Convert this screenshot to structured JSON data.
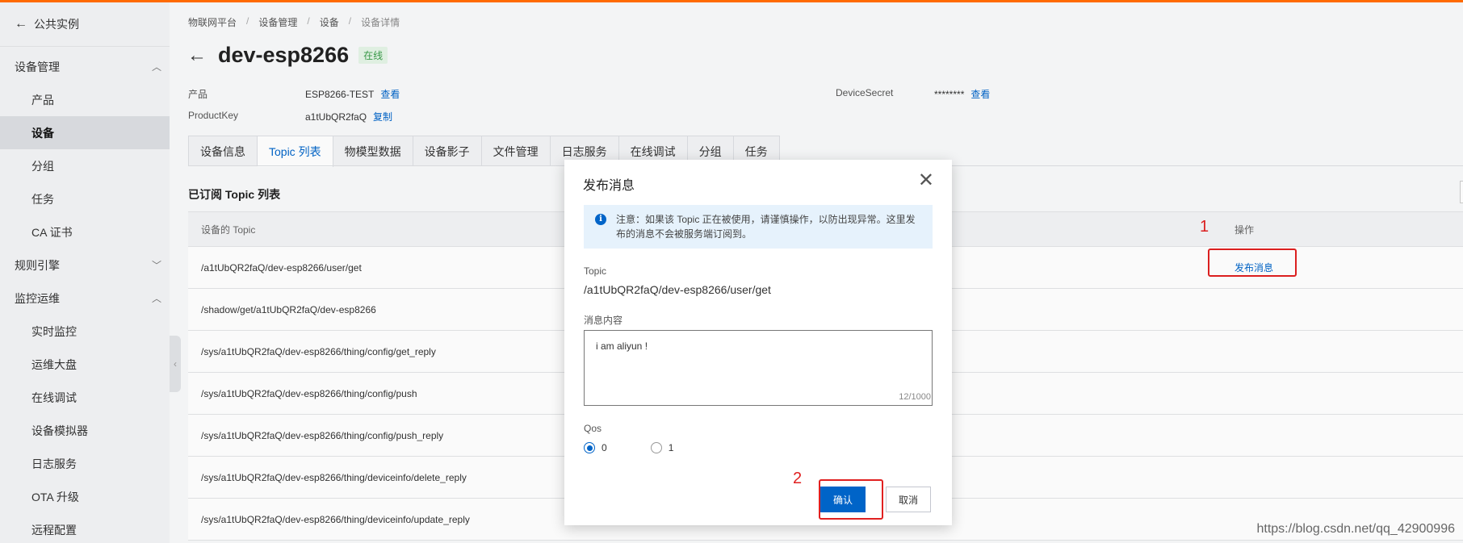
{
  "sidebar": {
    "back_label": "公共实例",
    "groups": [
      {
        "label": "设备管理",
        "chevron": "up"
      },
      {
        "label": "规则引擎",
        "chevron": "down"
      },
      {
        "label": "监控运维",
        "chevron": "up"
      }
    ],
    "device_items": [
      "产品",
      "设备",
      "分组",
      "任务",
      "CA 证书"
    ],
    "ops_items": [
      "实时监控",
      "运维大盘",
      "在线调试",
      "设备模拟器",
      "日志服务",
      "OTA 升级",
      "远程配置"
    ],
    "active_item": "设备"
  },
  "breadcrumb": [
    "物联网平台",
    "设备管理",
    "设备",
    "设备详情"
  ],
  "device": {
    "name": "dev-esp8266",
    "status": "在线",
    "product_label": "产品",
    "product_value": "ESP8266-TEST",
    "product_link": "查看",
    "productkey_label": "ProductKey",
    "productkey_value": "a1tUbQR2faQ",
    "productkey_link": "复制",
    "secret_label": "DeviceSecret",
    "secret_value": "********",
    "secret_link": "查看"
  },
  "tabs": [
    "设备信息",
    "Topic 列表",
    "物模型数据",
    "设备影子",
    "文件管理",
    "日志服务",
    "在线调试",
    "分组",
    "任务"
  ],
  "active_tab": "Topic 列表",
  "topic_section": {
    "title": "已订阅 Topic 列表",
    "col_topic": "设备的 Topic",
    "col_action": "操作",
    "rows": [
      {
        "topic": "/a1tUbQR2faQ/dev-esp8266/user/get",
        "action": "发布消息"
      },
      {
        "topic": "/shadow/get/a1tUbQR2faQ/dev-esp8266",
        "action": ""
      },
      {
        "topic": "/sys/a1tUbQR2faQ/dev-esp8266/thing/config/get_reply",
        "action": ""
      },
      {
        "topic": "/sys/a1tUbQR2faQ/dev-esp8266/thing/config/push",
        "action": ""
      },
      {
        "topic": "/sys/a1tUbQR2faQ/dev-esp8266/thing/config/push_reply",
        "action": ""
      },
      {
        "topic": "/sys/a1tUbQR2faQ/dev-esp8266/thing/deviceinfo/delete_reply",
        "action": ""
      },
      {
        "topic": "/sys/a1tUbQR2faQ/dev-esp8266/thing/deviceinfo/update_reply",
        "action": ""
      }
    ]
  },
  "modal": {
    "title": "发布消息",
    "notice_line1": "注意：如果该 Topic 正在被使用，请谨慎操作，以防出现异常。这里发",
    "notice_line2": "布的消息不会被服务端订阅到。",
    "topic_label": "Topic",
    "topic_value": "/a1tUbQR2faQ/dev-esp8266/user/get",
    "content_label": "消息内容",
    "content_value": "i am aliyun !",
    "counter": "12/1000",
    "qos_label": "Qos",
    "qos_options": [
      "0",
      "1"
    ],
    "qos_selected": "0",
    "confirm_label": "确认",
    "cancel_label": "取消"
  },
  "annotations": {
    "step1": "1",
    "step2": "2",
    "color": "#e02020"
  },
  "watermark": "https://blog.csdn.net/qq_42900996",
  "colors": {
    "accent": "#0064c8",
    "status_green": "#3a9c4a",
    "top_bar": "#ff6a00"
  }
}
